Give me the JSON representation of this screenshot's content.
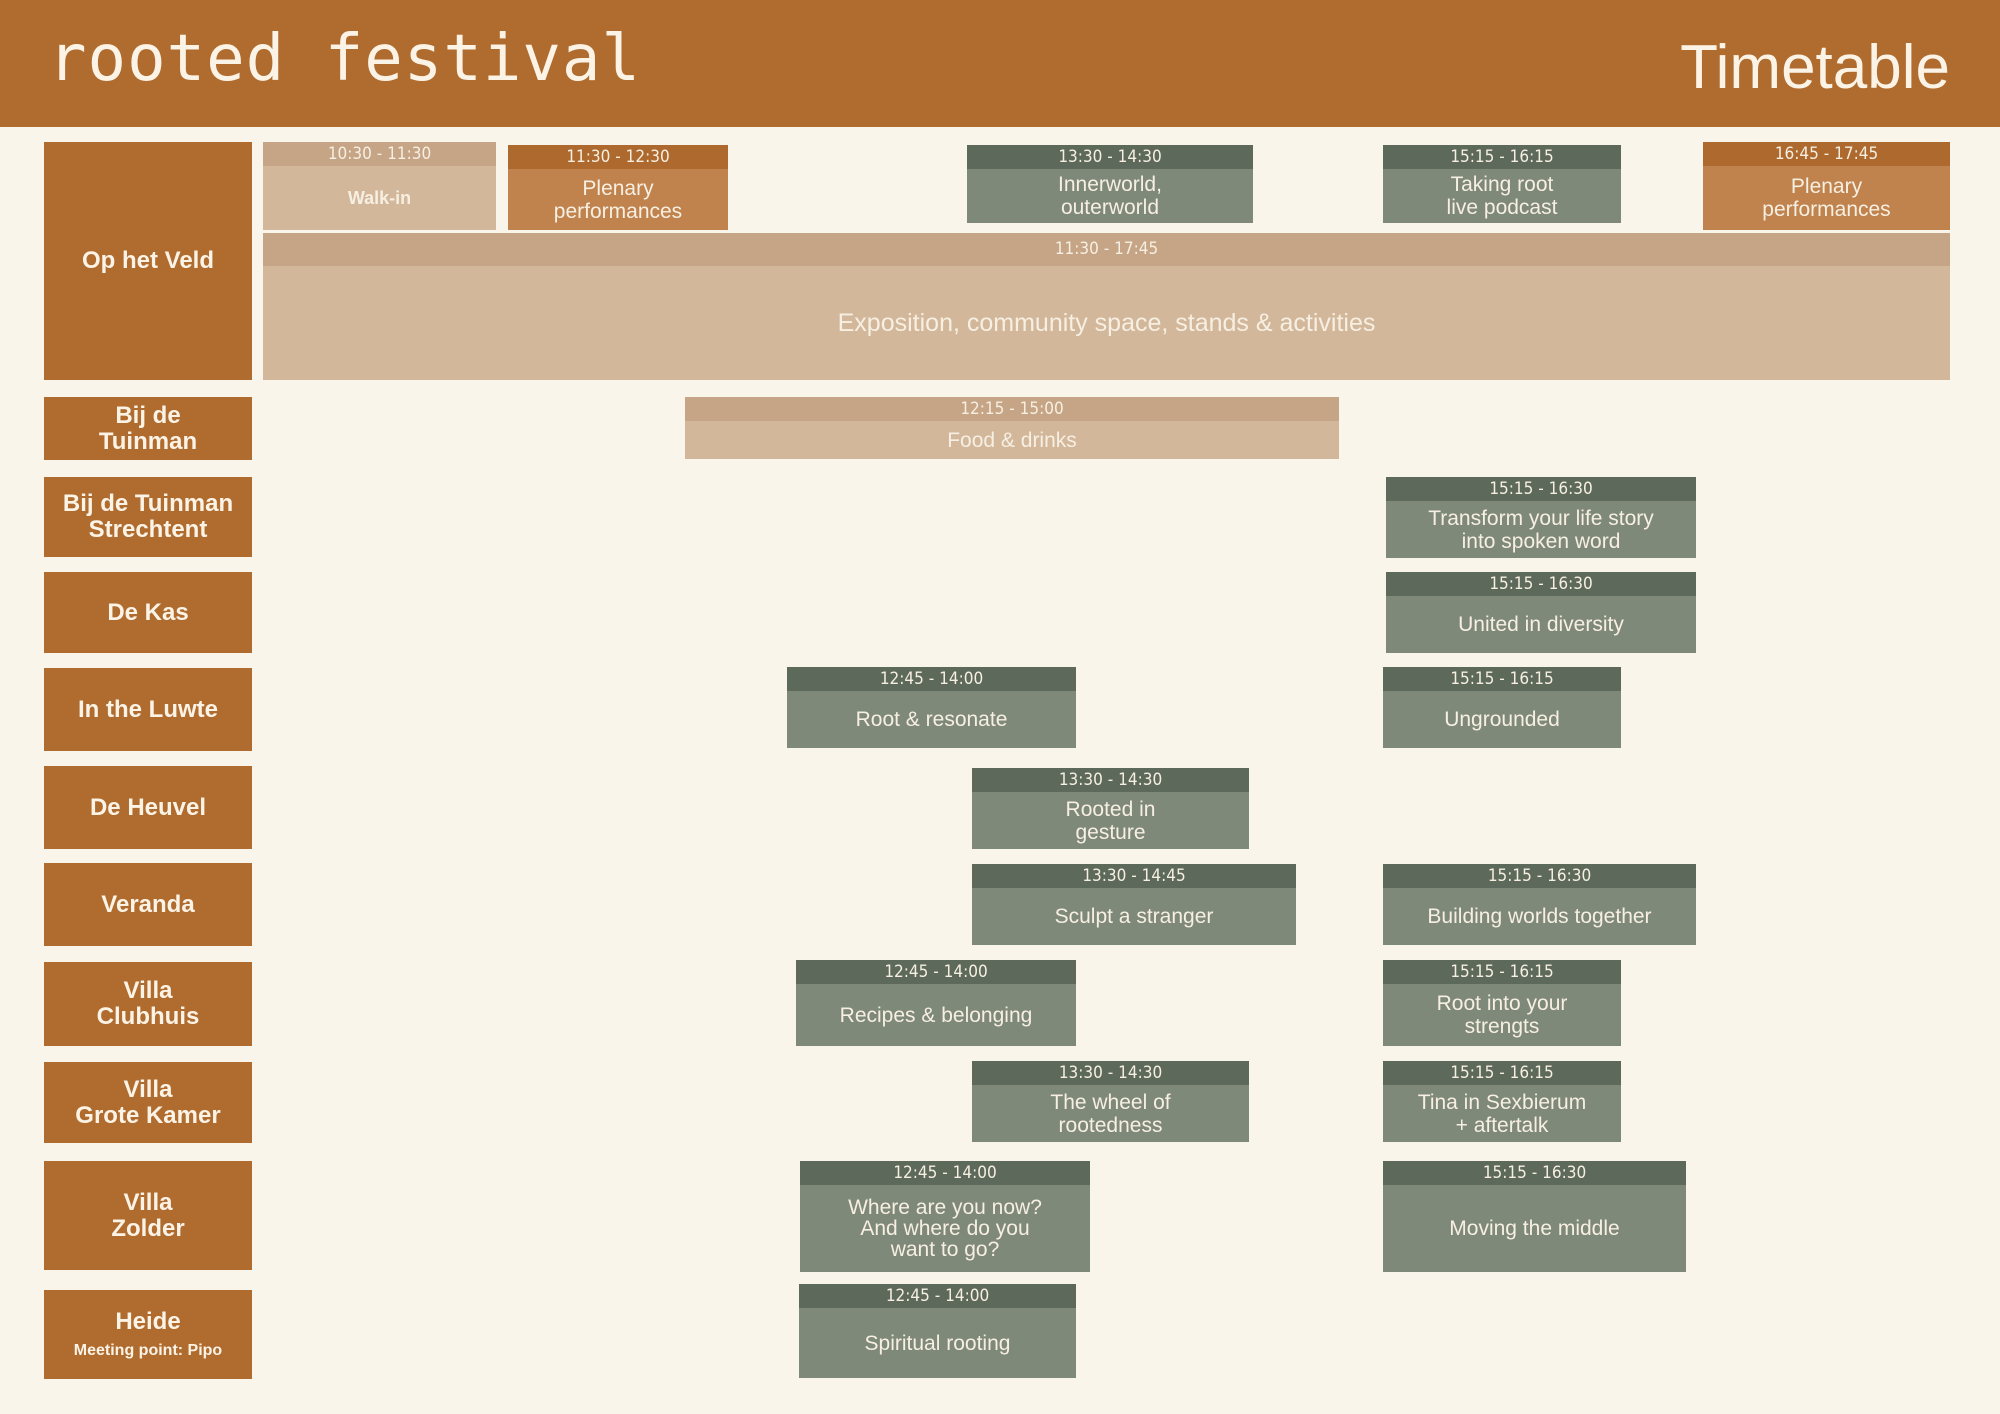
{
  "header": {
    "logo": "rooted festival",
    "title": "Timetable"
  },
  "rooms": [
    {
      "name": "Op het Veld"
    },
    {
      "name": "Bij de\nTuinman"
    },
    {
      "name": "Bij de Tuinman\nStrechtent"
    },
    {
      "name": "De Kas"
    },
    {
      "name": "In the Luwte"
    },
    {
      "name": "De Heuvel"
    },
    {
      "name": "Veranda"
    },
    {
      "name": "Villa\nClubhuis"
    },
    {
      "name": "Villa\nGrote Kamer"
    },
    {
      "name": "Villa\nZolder"
    },
    {
      "name": "Heide",
      "sub": "Meeting point: Pipo"
    }
  ],
  "events": [
    {
      "time": "10:30 - 11:30",
      "title": "Walk-in"
    },
    {
      "time": "11:30 - 12:30",
      "title": "Plenary\nperformances"
    },
    {
      "time": "13:30 - 14:30",
      "title": "Innerworld,\nouterworld"
    },
    {
      "time": "15:15 - 16:15",
      "title": "Taking root\nlive podcast"
    },
    {
      "time": "16:45 - 17:45",
      "title": "Plenary\nperformances"
    },
    {
      "time": "11:30 - 17:45",
      "title": "Exposition, community space, stands & activities"
    },
    {
      "time": "12:15 - 15:00",
      "title": "Food & drinks"
    },
    {
      "time": "15:15 - 16:30",
      "title": "Transform your life story\ninto spoken word"
    },
    {
      "time": "15:15 - 16:30",
      "title": "United in diversity"
    },
    {
      "time": "12:45 - 14:00",
      "title": "Root & resonate"
    },
    {
      "time": "15:15 - 16:15",
      "title": "Ungrounded"
    },
    {
      "time": "13:30 - 14:30",
      "title": "Rooted in\ngesture"
    },
    {
      "time": "13:30 - 14:45",
      "title": "Sculpt a stranger"
    },
    {
      "time": "15:15 - 16:30",
      "title": "Building worlds together"
    },
    {
      "time": "12:45 - 14:00",
      "title": "Recipes & belonging"
    },
    {
      "time": "15:15 - 16:15",
      "title": "Root into your\nstrengts"
    },
    {
      "time": "13:30 - 14:30",
      "title": "The wheel of\nrootedness"
    },
    {
      "time": "15:15 - 16:15",
      "title": "Tina in Sexbierum\n+ aftertalk"
    },
    {
      "time": "12:45 - 14:00",
      "title": "Where are you now?\nAnd where do you\nwant to go?"
    },
    {
      "time": "15:15 - 16:30",
      "title": "Moving the middle"
    },
    {
      "time": "12:45 - 14:00",
      "title": "Spiritual rooting"
    }
  ]
}
